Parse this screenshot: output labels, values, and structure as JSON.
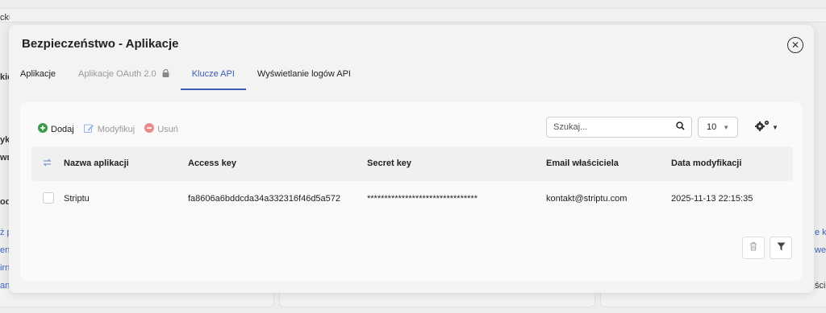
{
  "background": {
    "fragments": {
      "f1": "cku",
      "f2": "kie",
      "f3": "yko",
      "f4": "wn",
      "f5": "odz",
      "f6": "ż p",
      "f7": "ent",
      "f8": "irn",
      "f9": "an",
      "f10": "e k",
      "f11": "we",
      "f12": "ści"
    }
  },
  "modal": {
    "title": "Bezpieczeństwo - Aplikacje",
    "close_icon": "close-circle-icon"
  },
  "tabs": [
    {
      "label": "Aplikacje",
      "state": "normal"
    },
    {
      "label": "Aplikacje OAuth 2.0",
      "state": "disabled"
    },
    {
      "label": "Klucze API",
      "state": "active"
    },
    {
      "label": "Wyświetlanie logów API",
      "state": "normal"
    }
  ],
  "toolbar": {
    "add_label": "Dodaj",
    "edit_label": "Modyfikuj",
    "delete_label": "Usuń"
  },
  "search": {
    "placeholder": "Szukaj...",
    "value": ""
  },
  "page_size": {
    "value": "10"
  },
  "table": {
    "columns": [
      "Nazwa aplikacji",
      "Access key",
      "Secret key",
      "Email właściciela",
      "Data modyfikacji"
    ],
    "rows": [
      {
        "name": "Striptu",
        "access_key": "fa8606a6bddcda34a332316f46d5a572",
        "secret_key": "********************************",
        "email": "kontakt@striptu.com",
        "modified": "2025-11-13 22:15:35"
      }
    ]
  },
  "colors": {
    "accent": "#3b5ab7",
    "add_green": "#3a9a4a",
    "delete_red": "#e06b6b"
  }
}
